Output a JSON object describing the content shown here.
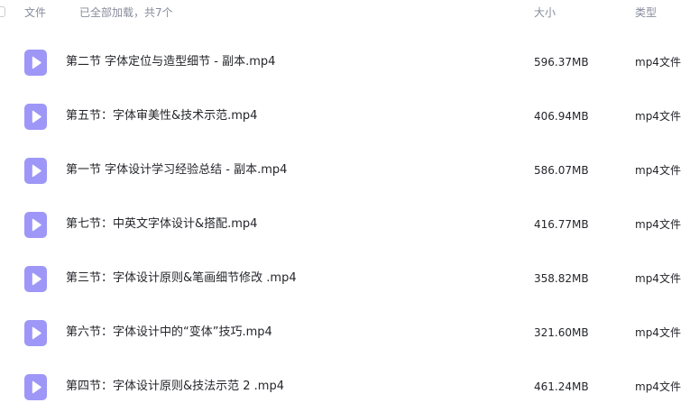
{
  "header": {
    "name_label": "文件",
    "status": "已全部加载，共7个",
    "size_label": "大小",
    "type_label": "类型"
  },
  "colors": {
    "video_icon": "#9e97f7",
    "header_text": "#878c9c",
    "row_text": "#25262b"
  },
  "files": [
    {
      "name": "第二节 字体定位与造型细节 - 副本.mp4",
      "size": "596.37MB",
      "type": "mp4文件",
      "icon": "video-file-icon"
    },
    {
      "name": "第五节：字体审美性&技术示范.mp4",
      "size": "406.94MB",
      "type": "mp4文件",
      "icon": "video-file-icon"
    },
    {
      "name": "第一节 字体设计学习经验总结 - 副本.mp4",
      "size": "586.07MB",
      "type": "mp4文件",
      "icon": "video-file-icon"
    },
    {
      "name": "第七节：中英文字体设计&搭配.mp4",
      "size": "416.77MB",
      "type": "mp4文件",
      "icon": "video-file-icon"
    },
    {
      "name": "第三节：字体设计原则&笔画细节修改 .mp4",
      "size": "358.82MB",
      "type": "mp4文件",
      "icon": "video-file-icon"
    },
    {
      "name": "第六节：字体设计中的“变体”技巧.mp4",
      "size": "321.60MB",
      "type": "mp4文件",
      "icon": "video-file-icon"
    },
    {
      "name": "第四节：字体设计原则&技法示范 2 .mp4",
      "size": "461.24MB",
      "type": "mp4文件",
      "icon": "video-file-icon"
    }
  ]
}
